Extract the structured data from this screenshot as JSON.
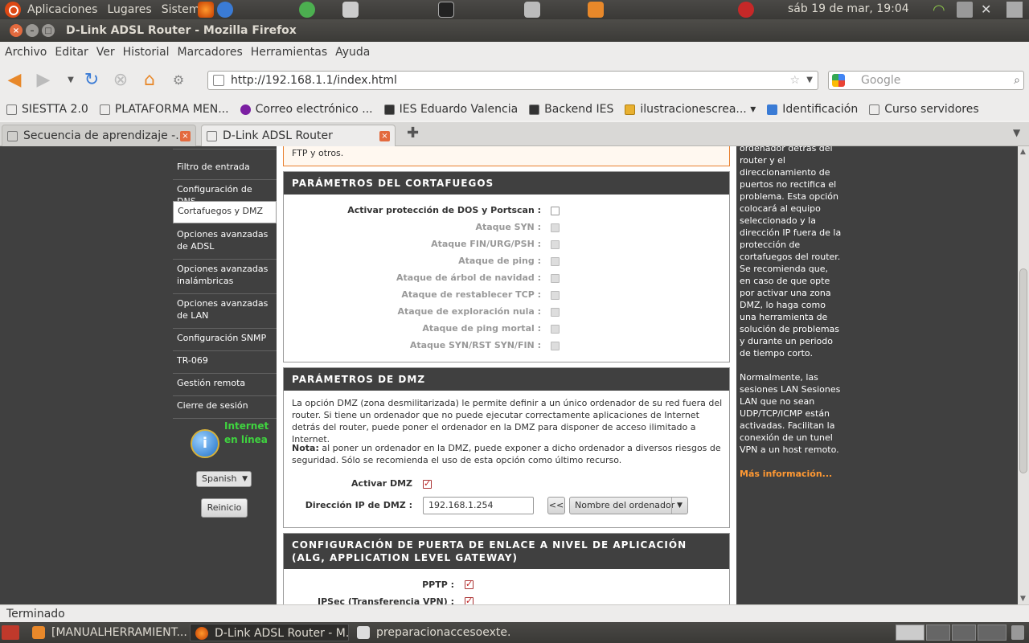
{
  "top_panel": {
    "menus": [
      "Aplicaciones",
      "Lugares",
      "Sistema"
    ],
    "clock": "sáb 19 de mar, 19:04"
  },
  "window": {
    "title": "D-Link ADSL Router - Mozilla Firefox"
  },
  "menubar": [
    "Archivo",
    "Editar",
    "Ver",
    "Historial",
    "Marcadores",
    "Herramientas",
    "Ayuda"
  ],
  "navigation": {
    "url": "http://192.168.1.1/index.html",
    "search_placeholder": "Google"
  },
  "bookmarks": [
    "SIESTTA 2.0",
    "PLATAFORMA MEN...",
    "Correo electrónico ...",
    "IES Eduardo Valencia",
    "Backend IES",
    "ilustracionescrea... ▾",
    "Identificación",
    "Curso servidores"
  ],
  "tabs": [
    {
      "label": "Secuencia de aprendizaje -..."
    },
    {
      "label": "D-Link ADSL Router"
    }
  ],
  "router": {
    "nav_items": [
      "Filtro de entrada",
      "Configuración de DNS",
      "Cortafuegos y DMZ",
      "Opciones avanzadas de ADSL",
      "Opciones avanzadas inalámbricas",
      "Opciones avanzadas de LAN",
      "Configuración SNMP",
      "TR-069",
      "Gestión remota",
      "Cierre de sesión"
    ],
    "online_status": "Internet en línea",
    "language": "Spanish",
    "reboot_label": "Reinicio",
    "top_fragment": "FTP y otros.",
    "firewall": {
      "heading": "PARÁMETROS DEL CORTAFUEGOS",
      "options": [
        {
          "label": "Activar protección de DOS y Portscan :",
          "enabled": true,
          "checked": false
        },
        {
          "label": "Ataque SYN :",
          "enabled": false,
          "checked": false
        },
        {
          "label": "Ataque FIN/URG/PSH :",
          "enabled": false,
          "checked": false
        },
        {
          "label": "Ataque de ping :",
          "enabled": false,
          "checked": false
        },
        {
          "label": "Ataque de árbol de navidad :",
          "enabled": false,
          "checked": false
        },
        {
          "label": "Ataque de restablecer TCP :",
          "enabled": false,
          "checked": false
        },
        {
          "label": "Ataque de exploración nula :",
          "enabled": false,
          "checked": false
        },
        {
          "label": "Ataque de ping mortal :",
          "enabled": false,
          "checked": false
        },
        {
          "label": "Ataque SYN/RST SYN/FIN :",
          "enabled": false,
          "checked": false
        }
      ]
    },
    "dmz": {
      "heading": "PARÁMETROS DE DMZ",
      "description": "La opción DMZ (zona desmilitarizada) le permite definir a un único ordenador de su red fuera del router. Si tiene un ordenador que no puede ejecutar correctamente aplicaciones de Internet detrás del router, puede poner el ordenador en la DMZ para disponer de acceso ilimitado a Internet.",
      "note_label": "Nota:",
      "note": " al poner un ordenador en la DMZ, puede exponer a dicho ordenador a diversos riesgos de seguridad. Sólo se recomienda el uso de esta opción como último recurso.",
      "activate_label": "Activar DMZ",
      "activate_checked": true,
      "ip_label": "Dirección IP de DMZ :",
      "ip_value": "192.168.1.254",
      "copy_button": "<<",
      "computer_select": "Nombre del ordenador"
    },
    "alg": {
      "heading": "CONFIGURACIÓN DE PUERTA DE ENLACE A NIVEL DE APLICACIÓN (ALG, APPLICATION LEVEL GATEWAY)",
      "options": [
        {
          "label": "PPTP :",
          "checked": true
        },
        {
          "label": "IPSec (Transferencia VPN) :",
          "checked": true
        }
      ]
    },
    "help": {
      "paragraph1": "ordenador detrás del router y el direccionamiento de puertos no rectifica el problema. Esta opción colocará al equipo seleccionado y la dirección IP fuera de la protección de cortafuegos del router. Se recomienda que, en caso de que opte por activar una zona DMZ, lo haga como una herramienta de solución de problemas y durante un periodo de tiempo corto.",
      "paragraph2": "Normalmente, las sesiones LAN Sesiones LAN que no sean UDP/TCP/ICMP están activadas. Facilitan la conexión de un tunel VPN a un host remoto.",
      "more_link": "Más información..."
    }
  },
  "statusbar": "Terminado",
  "taskbar": [
    {
      "label": "[MANUALHERRAMIENT...",
      "active": false
    },
    {
      "label": "D-Link ADSL Router - M...",
      "active": true
    },
    {
      "label": "preparacionaccesoexte...",
      "active": false
    }
  ],
  "colors": {
    "router_dark": "#404040",
    "help_link": "#ff9933",
    "online_green": "#3fd43f"
  }
}
